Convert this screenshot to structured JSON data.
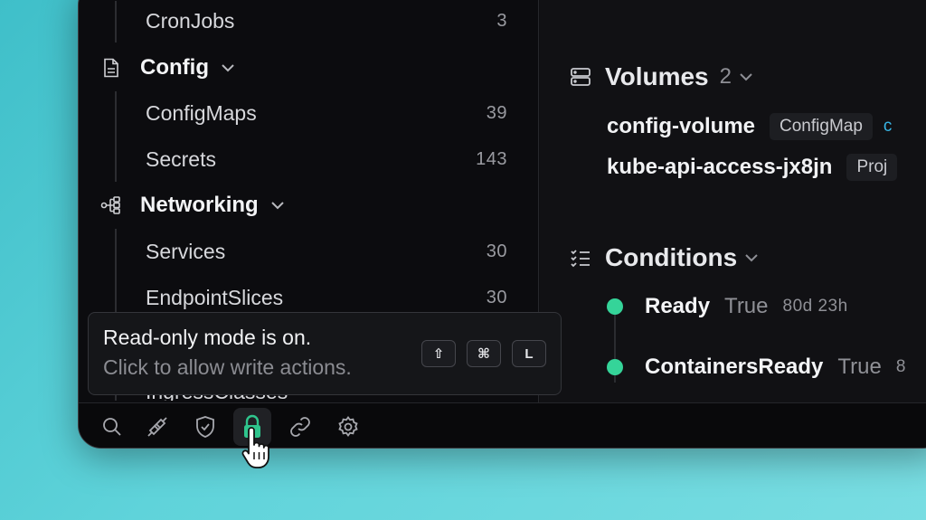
{
  "sidebar": {
    "partial_top_item": {
      "label": "CronJobs",
      "count": "3"
    },
    "config_group": {
      "label": "Config",
      "icon": "document-icon",
      "items": [
        {
          "label": "ConfigMaps",
          "count": "39"
        },
        {
          "label": "Secrets",
          "count": "143"
        }
      ]
    },
    "networking_group": {
      "label": "Networking",
      "icon": "network-icon",
      "items": [
        {
          "label": "Services",
          "count": "30"
        },
        {
          "label": "EndpointSlices",
          "count": "30"
        },
        {
          "label": "IngressClasses",
          "count": ""
        }
      ]
    }
  },
  "tooltip": {
    "title": "Read-only mode is on.",
    "subtitle": "Click to allow write actions.",
    "shortcut": [
      "⇧",
      "⌘",
      "L"
    ]
  },
  "main": {
    "volumes": {
      "title": "Volumes",
      "count": "2",
      "items": [
        {
          "name": "config-volume",
          "type": "ConfigMap",
          "extra": "c"
        },
        {
          "name": "kube-api-access-jx8jn",
          "type": "Proj"
        }
      ]
    },
    "conditions": {
      "title": "Conditions",
      "items": [
        {
          "name": "Ready",
          "value": "True",
          "age": "80d 23h"
        },
        {
          "name": "ContainersReady",
          "value": "True",
          "age": "8"
        }
      ]
    }
  },
  "bottom_bar": {
    "icons": [
      "search-icon",
      "plug-icon",
      "shield-check-icon",
      "lock-icon",
      "link-icon",
      "settings-icon"
    ],
    "active": "lock-icon"
  },
  "colors": {
    "status_green": "#35d499",
    "accent_lock": "#2fc58d",
    "background_gradient": "#5fd3da",
    "window_bg": "#0f0f12"
  }
}
